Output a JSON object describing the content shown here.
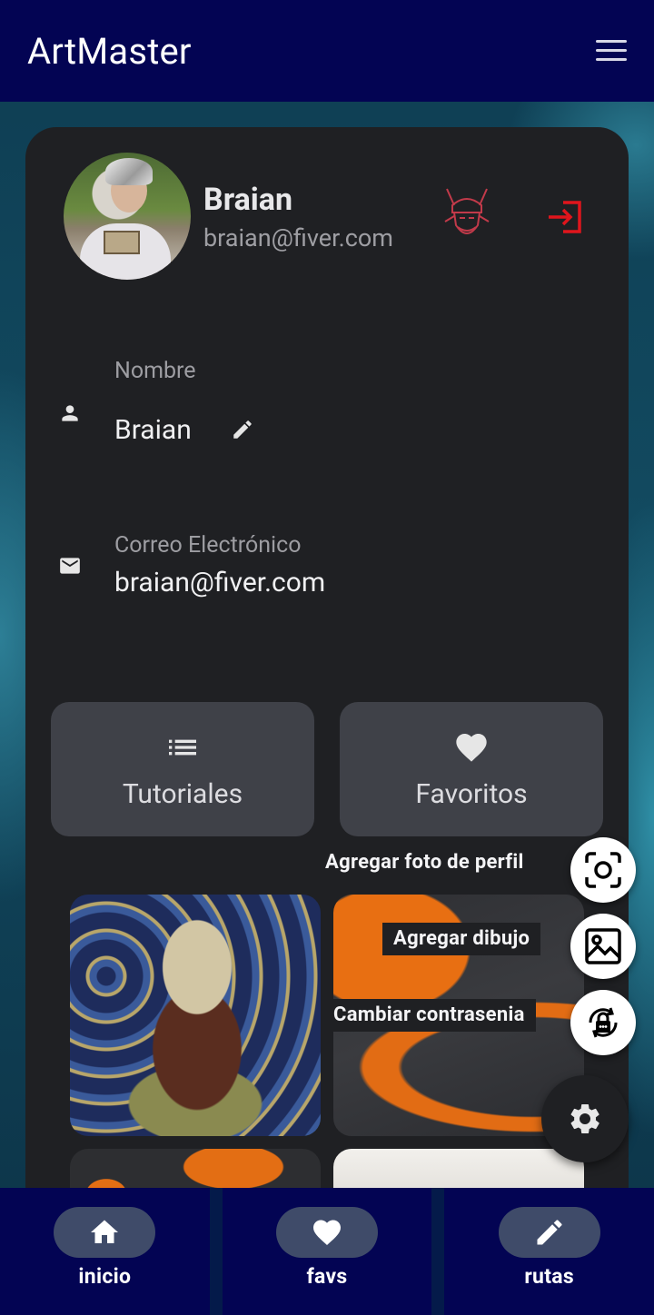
{
  "app": {
    "title": "ArtMaster"
  },
  "profile": {
    "name": "Braian",
    "email": "braian@fiver.com"
  },
  "fields": {
    "name_label": "Nombre",
    "name_value": "Braian",
    "email_label": "Correo Electrónico",
    "email_value": "braian@fiver.com"
  },
  "tiles": {
    "tutorials": "Tutoriales",
    "favorites": "Favoritos"
  },
  "fab_menu": {
    "add_photo": "Agregar foto de perfil",
    "add_drawing": "Agregar dibujo",
    "change_password": "Cambiar contrasenia"
  },
  "bottom_nav": [
    {
      "label": "inicio",
      "icon": "home-icon"
    },
    {
      "label": "favs",
      "icon": "heart-icon"
    },
    {
      "label": "rutas",
      "icon": "pencil-icon"
    }
  ],
  "colors": {
    "appbar": "#030453",
    "card": "#1f2023",
    "tile": "#3f4148",
    "logout": "#e0151c",
    "nav_pill": "#3f4b69"
  }
}
